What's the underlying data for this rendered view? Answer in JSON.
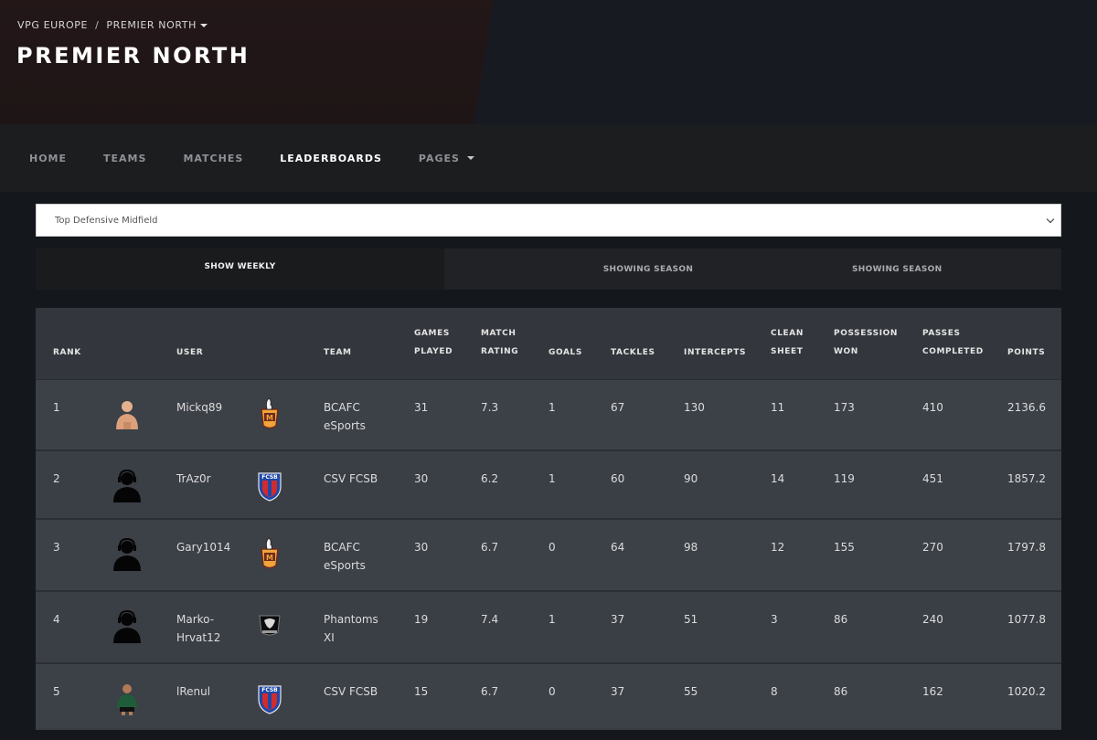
{
  "breadcrumb": {
    "root": "VPG EUROPE",
    "separator": "/",
    "current": "PREMIER NORTH"
  },
  "page_title": "PREMIER NORTH",
  "nav": {
    "items": [
      {
        "label": "HOME"
      },
      {
        "label": "TEAMS"
      },
      {
        "label": "MATCHES"
      },
      {
        "label": "LEADERBOARDS",
        "active": true
      },
      {
        "label": "PAGES",
        "dropdown": true
      }
    ]
  },
  "select": {
    "value": "Top Defensive Midfield"
  },
  "tabs": {
    "weekly": "SHOW WEEKLY",
    "season1": "SHOWING SEASON",
    "season2": "SHOWING SEASON"
  },
  "table": {
    "headers": {
      "rank": "RANK",
      "user": "USER",
      "team": "TEAM",
      "games_played_1": "GAMES",
      "games_played_2": "PLAYED",
      "match_rating_1": "MATCH",
      "match_rating_2": "RATING",
      "goals": "GOALS",
      "tackles": "TACKLES",
      "intercepts": "INTERCEPTS",
      "clean_sheet_1": "CLEAN",
      "clean_sheet_2": "SHEET",
      "possession_won_1": "POSSESSION",
      "possession_won_2": "WON",
      "passes_completed_1": "PASSES",
      "passes_completed_2": "COMPLETED",
      "points": "POINTS"
    },
    "rows": [
      {
        "rank": "1",
        "user1": "Mickq89",
        "user2": "",
        "team1": "BCAFC",
        "team2": "eSports",
        "gp": "31",
        "mr": "7.3",
        "goals": "1",
        "tackles": "67",
        "intercepts": "130",
        "cs": "11",
        "pw": "173",
        "pc": "410",
        "points": "2136.6",
        "avatar": "skin-avatar-icon",
        "crest": "bcafc-crest-icon"
      },
      {
        "rank": "2",
        "user1": "TrAz0r",
        "user2": "",
        "team1": "CSV FCSB",
        "team2": "",
        "gp": "30",
        "mr": "6.2",
        "goals": "1",
        "tackles": "60",
        "intercepts": "90",
        "cs": "14",
        "pw": "119",
        "pc": "451",
        "points": "1857.2",
        "avatar": "silhouette-avatar-icon",
        "crest": "fcsb-crest-icon"
      },
      {
        "rank": "3",
        "user1": "Gary1014",
        "user2": "",
        "team1": "BCAFC",
        "team2": "eSports",
        "gp": "30",
        "mr": "6.7",
        "goals": "0",
        "tackles": "64",
        "intercepts": "98",
        "cs": "12",
        "pw": "155",
        "pc": "270",
        "points": "1797.8",
        "avatar": "silhouette-avatar-icon",
        "crest": "bcafc-crest-icon"
      },
      {
        "rank": "4",
        "user1": "Marko-",
        "user2": "Hrvat12",
        "team1": "Phantoms",
        "team2": "XI",
        "gp": "19",
        "mr": "7.4",
        "goals": "1",
        "tackles": "37",
        "intercepts": "51",
        "cs": "3",
        "pw": "86",
        "pc": "240",
        "points": "1077.8",
        "avatar": "silhouette-avatar-icon",
        "crest": "phantoms-crest-icon"
      },
      {
        "rank": "5",
        "user1": "lRenul",
        "user2": "",
        "team1": "CSV FCSB",
        "team2": "",
        "gp": "15",
        "mr": "6.7",
        "goals": "0",
        "tackles": "37",
        "intercepts": "55",
        "cs": "8",
        "pw": "86",
        "pc": "162",
        "points": "1020.2",
        "avatar": "player-avatar-icon",
        "crest": "fcsb-crest-icon"
      }
    ]
  },
  "colors": {
    "background": "#14171c",
    "nav": "#1c1d1f",
    "table_row": "#3c4047",
    "header_accent": "#231718"
  }
}
